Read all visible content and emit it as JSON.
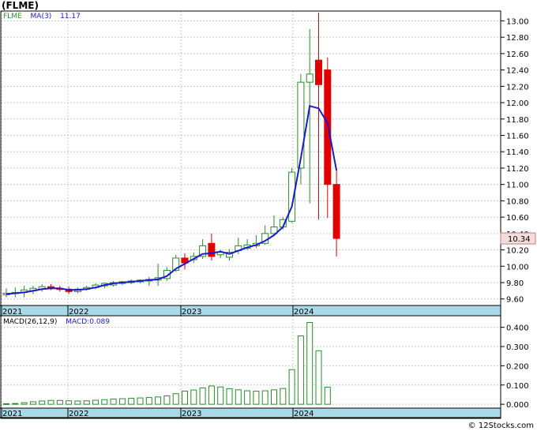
{
  "title": "(FLME)",
  "legend": {
    "symbol": "FLME",
    "ma_label": "MA(3)",
    "ma_value": "11.17",
    "macd_label": "MACD(26,12,9)",
    "macd_value": "MACD:0.089"
  },
  "footer": "© 12Stocks.com",
  "colors": {
    "up": "#2a8a2a",
    "down": "#e00000",
    "ma": "#1a1acc",
    "axis_band": "#a9d8e6",
    "grid": "#c8c8c8"
  },
  "chart_data": [
    {
      "type": "candlestick",
      "title": "(FLME)",
      "x_labels": [
        "2021",
        "2022",
        "2023",
        "2024"
      ],
      "y_ticks": [
        "9.60",
        "9.80",
        "10.00",
        "10.20",
        "10.40",
        "10.60",
        "10.80",
        "11.00",
        "11.20",
        "11.40",
        "11.60",
        "11.80",
        "12.00",
        "12.20",
        "12.40",
        "12.60",
        "12.80",
        "13.00"
      ],
      "ylim": [
        9.52,
        13.12
      ],
      "last_price": "10.34",
      "candles": [
        {
          "o": 9.65,
          "h": 9.73,
          "l": 9.62,
          "c": 9.67
        },
        {
          "o": 9.67,
          "h": 9.74,
          "l": 9.62,
          "c": 9.68
        },
        {
          "o": 9.68,
          "h": 9.76,
          "l": 9.62,
          "c": 9.71
        },
        {
          "o": 9.7,
          "h": 9.76,
          "l": 9.66,
          "c": 9.73
        },
        {
          "o": 9.72,
          "h": 9.78,
          "l": 9.69,
          "c": 9.75
        },
        {
          "o": 9.75,
          "h": 9.78,
          "l": 9.71,
          "c": 9.73
        },
        {
          "o": 9.73,
          "h": 9.76,
          "l": 9.69,
          "c": 9.72
        },
        {
          "o": 9.72,
          "h": 9.75,
          "l": 9.66,
          "c": 9.69
        },
        {
          "o": 9.69,
          "h": 9.74,
          "l": 9.67,
          "c": 9.72
        },
        {
          "o": 9.72,
          "h": 9.76,
          "l": 9.7,
          "c": 9.74
        },
        {
          "o": 9.74,
          "h": 9.79,
          "l": 9.72,
          "c": 9.77
        },
        {
          "o": 9.76,
          "h": 9.8,
          "l": 9.73,
          "c": 9.79
        },
        {
          "o": 9.77,
          "h": 9.82,
          "l": 9.75,
          "c": 9.8
        },
        {
          "o": 9.79,
          "h": 9.82,
          "l": 9.77,
          "c": 9.81
        },
        {
          "o": 9.8,
          "h": 9.84,
          "l": 9.78,
          "c": 9.82
        },
        {
          "o": 9.81,
          "h": 9.84,
          "l": 9.79,
          "c": 9.83
        },
        {
          "o": 9.82,
          "h": 9.87,
          "l": 9.76,
          "c": 9.84
        },
        {
          "o": 9.83,
          "h": 10.03,
          "l": 9.76,
          "c": 9.86
        },
        {
          "o": 9.85,
          "h": 9.99,
          "l": 9.82,
          "c": 9.95
        },
        {
          "o": 9.95,
          "h": 10.14,
          "l": 9.93,
          "c": 10.1
        },
        {
          "o": 10.1,
          "h": 10.16,
          "l": 9.96,
          "c": 10.04
        },
        {
          "o": 10.08,
          "h": 10.17,
          "l": 10.04,
          "c": 10.12
        },
        {
          "o": 10.12,
          "h": 10.33,
          "l": 10.09,
          "c": 10.25
        },
        {
          "o": 10.28,
          "h": 10.4,
          "l": 10.07,
          "c": 10.12
        },
        {
          "o": 10.14,
          "h": 10.2,
          "l": 10.1,
          "c": 10.17
        },
        {
          "o": 10.11,
          "h": 10.21,
          "l": 10.07,
          "c": 10.17
        },
        {
          "o": 10.19,
          "h": 10.35,
          "l": 10.15,
          "c": 10.25
        },
        {
          "o": 10.22,
          "h": 10.33,
          "l": 10.2,
          "c": 10.26
        },
        {
          "o": 10.25,
          "h": 10.38,
          "l": 10.22,
          "c": 10.28
        },
        {
          "o": 10.28,
          "h": 10.5,
          "l": 10.26,
          "c": 10.4
        },
        {
          "o": 10.4,
          "h": 10.62,
          "l": 10.38,
          "c": 10.48
        },
        {
          "o": 10.48,
          "h": 10.6,
          "l": 10.45,
          "c": 10.57
        },
        {
          "o": 10.55,
          "h": 11.2,
          "l": 10.53,
          "c": 11.15
        },
        {
          "o": 11.2,
          "h": 12.35,
          "l": 11.0,
          "c": 12.25
        },
        {
          "o": 12.25,
          "h": 12.9,
          "l": 10.77,
          "c": 12.35
        },
        {
          "o": 12.52,
          "h": 13.1,
          "l": 10.57,
          "c": 12.22
        },
        {
          "o": 12.4,
          "h": 12.55,
          "l": 10.59,
          "c": 11.0
        },
        {
          "o": 11.0,
          "h": 11.2,
          "l": 10.12,
          "c": 10.34
        }
      ],
      "ma3": [
        9.66,
        9.67,
        9.68,
        9.7,
        9.72,
        9.73,
        9.73,
        9.71,
        9.71,
        9.72,
        9.74,
        9.77,
        9.79,
        9.8,
        9.81,
        9.82,
        9.83,
        9.84,
        9.88,
        9.97,
        10.03,
        10.09,
        10.15,
        10.16,
        10.18,
        10.15,
        10.19,
        10.23,
        10.26,
        10.31,
        10.38,
        10.48,
        10.73,
        11.32,
        11.96,
        11.93,
        11.75,
        11.17
      ]
    },
    {
      "type": "bar",
      "title": "MACD(26,12,9)",
      "x_labels": [
        "2021",
        "2022",
        "2023",
        "2024"
      ],
      "y_ticks": [
        "0.000",
        "0.100",
        "0.200",
        "0.300",
        "0.400"
      ],
      "ylim": [
        -0.02,
        0.46
      ],
      "values": [
        0.003,
        0.004,
        0.008,
        0.013,
        0.017,
        0.02,
        0.02,
        0.018,
        0.017,
        0.018,
        0.021,
        0.024,
        0.027,
        0.029,
        0.031,
        0.033,
        0.035,
        0.038,
        0.044,
        0.055,
        0.068,
        0.074,
        0.085,
        0.095,
        0.09,
        0.081,
        0.075,
        0.07,
        0.068,
        0.07,
        0.075,
        0.082,
        0.18,
        0.355,
        0.425,
        0.278,
        0.089
      ]
    }
  ]
}
